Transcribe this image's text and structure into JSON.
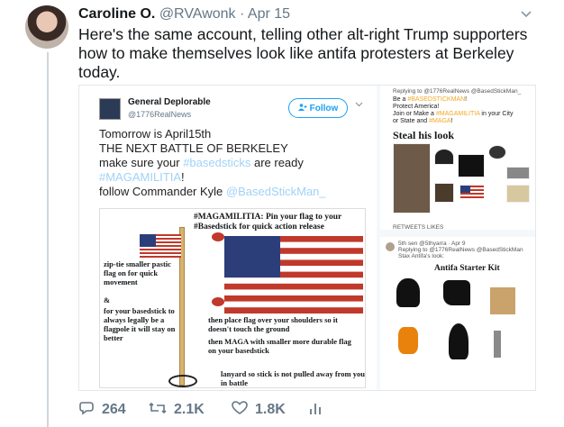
{
  "tweet": {
    "author_name": "Caroline O.",
    "author_handle": "@RVAwonk",
    "separator": "·",
    "date": "Apr 15",
    "text": "Here's the same account, telling other alt-right Trump supporters how to make themselves look like antifa protesters at Berkeley today."
  },
  "embedded": {
    "name": "General Deplorable",
    "handle": "@1776RealNews",
    "follow_label": "Follow",
    "line1": "Tomorrow is April15th",
    "line2": "THE NEXT BATTLE OF BERKELEY",
    "line3_pre": "make sure your ",
    "line3_link": "#basedsticks",
    "line3_post": " are ready",
    "line4_link": "#MAGAMILITIA",
    "line4_post": "!",
    "line5_pre": "follow Commander Kyle ",
    "line5_link": "@BasedStickMan_"
  },
  "poster": {
    "title": "#MAGAMILITIA: Pin your flag to your #Basedstick for quick action release",
    "note_ziptie": "zip-tie smaller pastic flag on for quick movement",
    "note_amp": "&",
    "note_legal": "for your basedstick to always legally be a flagpole it will stay on better",
    "note_shoulders": "then place flag over your shoulders so it doesn't touch the ground",
    "note_maga": "then MAGA with smaller more durable flag on your basedstick",
    "note_lanyard": "lanyard so stick is not pulled away from you in battle"
  },
  "right_top": {
    "replying": "Replying to @1776RealNews @BasedStickMan_",
    "l1_pre": "Be a ",
    "l1_hl": "#BASEDSTICKMAN",
    "l1_post": "!",
    "l2": "Protect America!",
    "l3_pre": "Join or Make a ",
    "l3_hl": "#MAGAMILITIA",
    "l3_post": " in your City",
    "l4_pre": "or State and ",
    "l4_hl": "#MAGA",
    "l4_post": "!",
    "steal": "Steal his look",
    "retweets_label": "RETWEETS LIKES"
  },
  "right_bottom": {
    "meta": "5th sen @5thyarra · Apr 9",
    "replying": "Replying to @1776RealNews @BasedStickMan",
    "sub": "Stax Antifa's look:",
    "title": "Antifa Starter Kit"
  },
  "actions": {
    "replies": "264",
    "retweets": "2.1K",
    "likes": "1.8K"
  },
  "colors": {
    "twitter_blue": "#1da1f2",
    "muted": "#657786",
    "hashtag_highlight": "#f5a623"
  }
}
